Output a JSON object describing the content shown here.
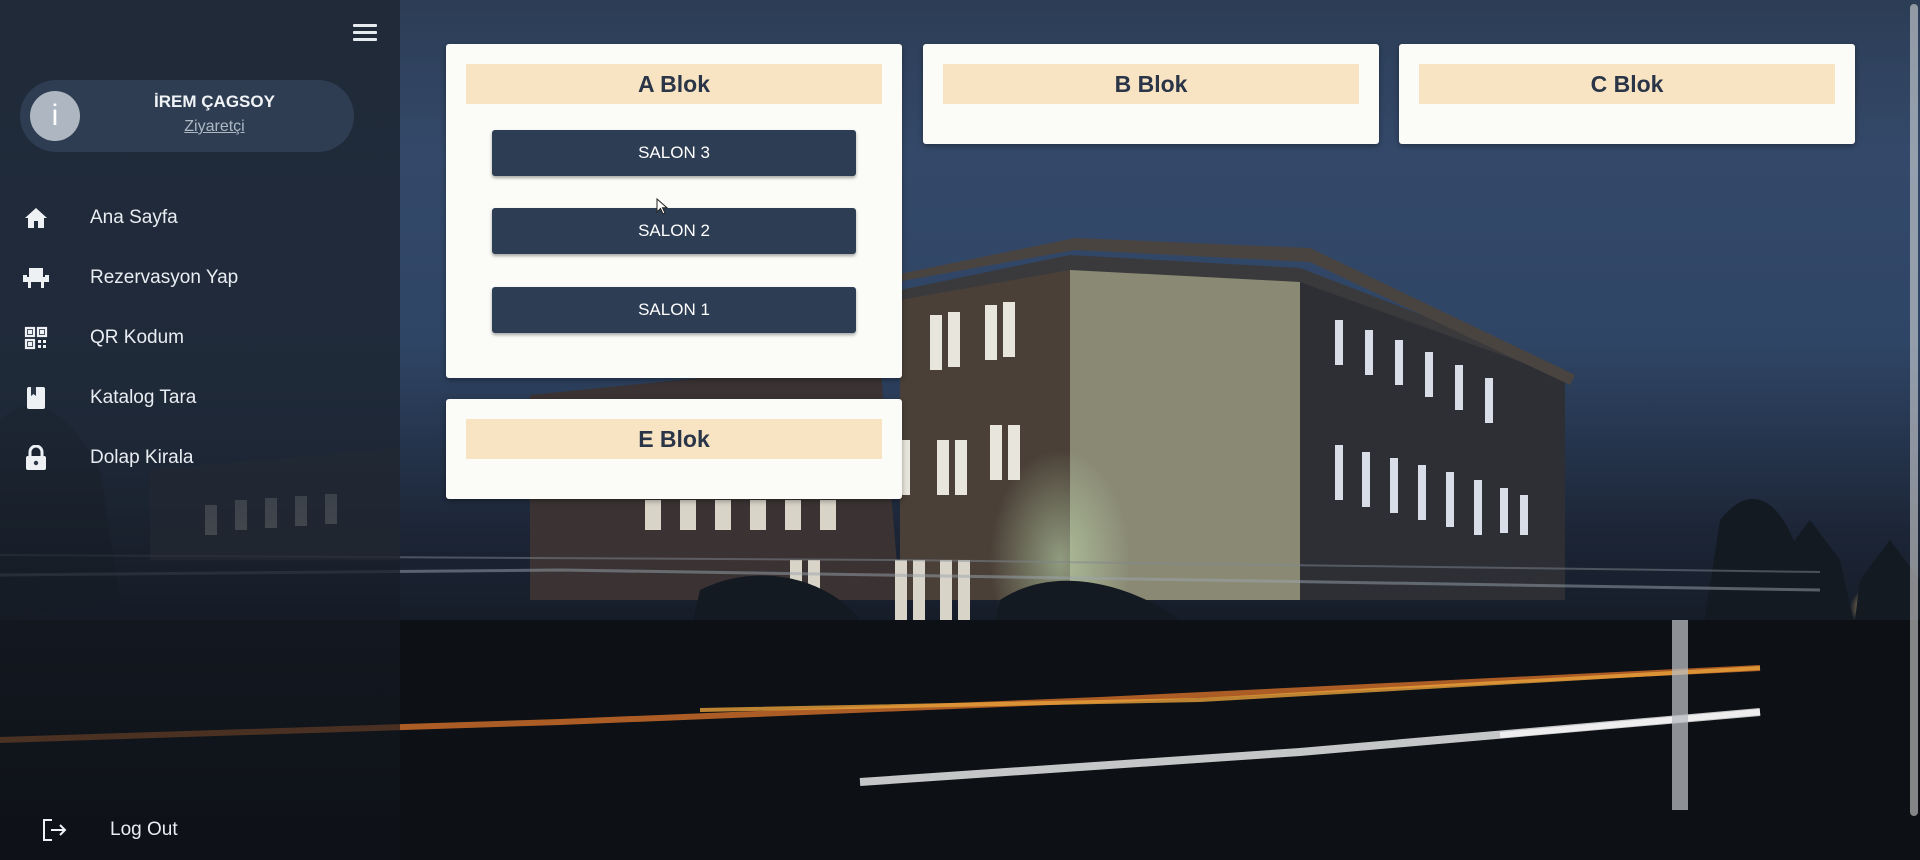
{
  "user": {
    "initial": "i",
    "name": "İREM ÇAGSOY",
    "role": "Ziyaretçi"
  },
  "sidebar": {
    "items": [
      {
        "label": "Ana Sayfa",
        "icon": "home-icon"
      },
      {
        "label": "Rezervasyon Yap",
        "icon": "seat-icon"
      },
      {
        "label": "QR Kodum",
        "icon": "qr-code-icon"
      },
      {
        "label": "Katalog Tara",
        "icon": "book-icon"
      },
      {
        "label": "Dolap Kirala",
        "icon": "lock-icon"
      }
    ],
    "logout_label": "Log Out",
    "logout_icon": "logout-icon",
    "menu_icon": "hamburger-menu-icon"
  },
  "blocks": {
    "a": {
      "title": "A Blok",
      "salons": [
        "SALON 3",
        "SALON 2",
        "SALON 1"
      ]
    },
    "b": {
      "title": "B Blok"
    },
    "c": {
      "title": "C Blok"
    },
    "e": {
      "title": "E Blok"
    }
  },
  "colors": {
    "sidebar_bg": "#1e2836",
    "card_bg": "#fbfbf8",
    "card_header": "#f8e3c2",
    "button_bg": "#2d3d53",
    "heading_text": "#2a3548"
  }
}
